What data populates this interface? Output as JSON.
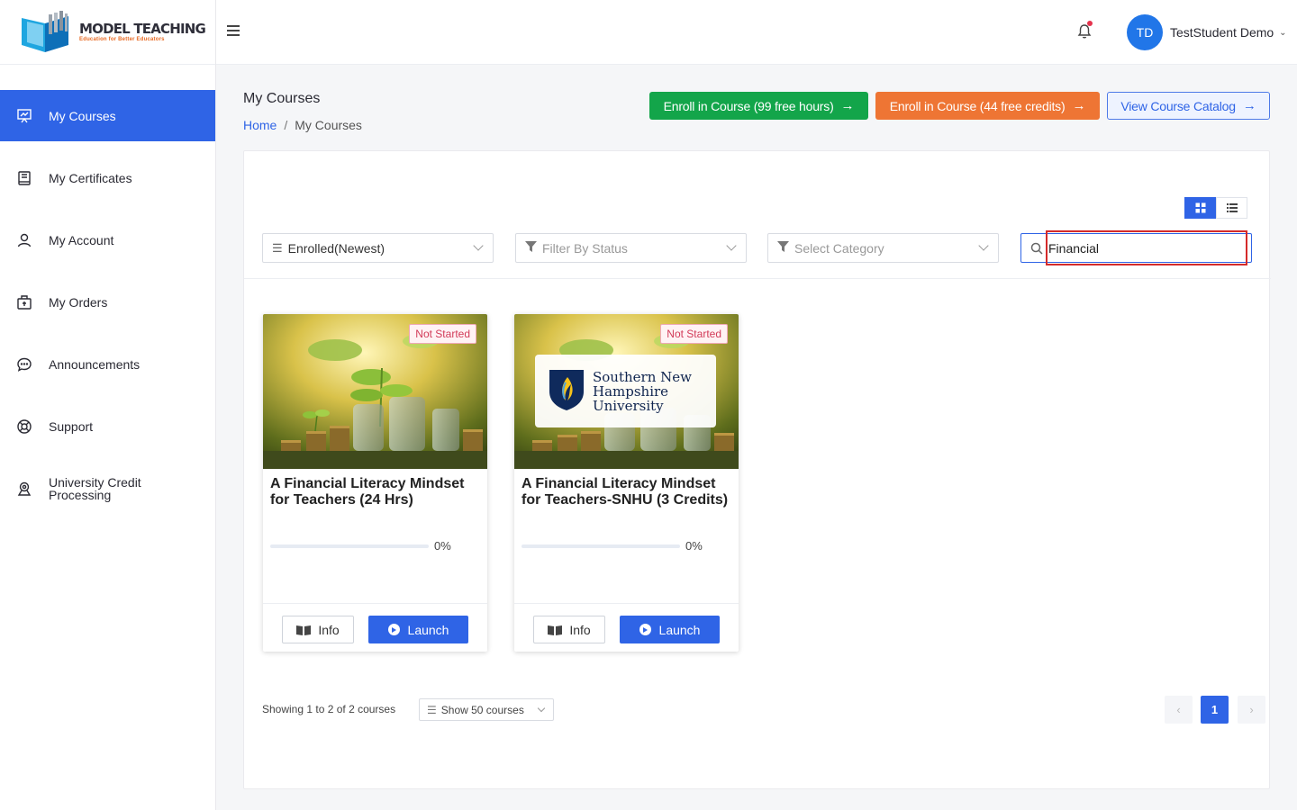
{
  "brand": {
    "title": "MODEL TEACHING",
    "tagline": "Education for Better Educators"
  },
  "sidebar": {
    "items": [
      {
        "label": "My Courses",
        "icon": "courses-icon",
        "active": true
      },
      {
        "label": "My Certificates",
        "icon": "certificate-icon"
      },
      {
        "label": "My Account",
        "icon": "user-icon"
      },
      {
        "label": "My Orders",
        "icon": "orders-icon"
      },
      {
        "label": "Announcements",
        "icon": "chat-icon"
      },
      {
        "label": "Support",
        "icon": "support-icon"
      },
      {
        "label": "University Credit Processing",
        "icon": "university-icon"
      }
    ]
  },
  "header": {
    "user_initials": "TD",
    "user_name": "TestStudent Demo"
  },
  "page": {
    "title": "My Courses",
    "breadcrumb": {
      "home": "Home",
      "separator": "/",
      "current": "My Courses"
    },
    "actions": {
      "enroll_hours": "Enroll in Course (99 free hours)",
      "enroll_credits": "Enroll in Course (44 free credits)",
      "catalog": "View Course Catalog"
    }
  },
  "filters": {
    "sort_value": "Enrolled(Newest)",
    "status_placeholder": "Filter By Status",
    "category_placeholder": "Select Category",
    "search_value": "Financial"
  },
  "courses": [
    {
      "status": "Not Started",
      "title": "A Financial Literacy Mindset for Teachers (24 Hrs)",
      "progress_text": "0%",
      "progress": 0,
      "info_label": "Info",
      "launch_label": "Launch"
    },
    {
      "status": "Not Started",
      "title": "A Financial Literacy Mindset for Teachers-SNHU (3 Credits)",
      "progress_text": "0%",
      "progress": 0,
      "logo_text": "Southern New Hampshire University",
      "info_label": "Info",
      "launch_label": "Launch"
    }
  ],
  "footer": {
    "showing": "Showing 1 to 2 of 2 courses",
    "per_page": "Show 50 courses",
    "pages": {
      "prev": "‹",
      "current": "1",
      "next": "›"
    }
  },
  "colors": {
    "primary": "#2f64e6",
    "green": "#13a54a",
    "orange": "#ee7534",
    "badge": "#d23b59"
  }
}
